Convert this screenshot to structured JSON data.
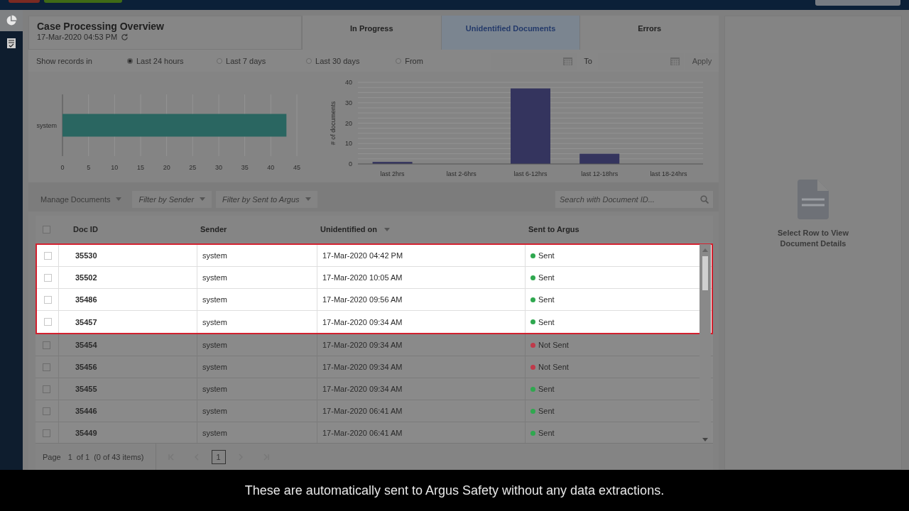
{
  "header": {
    "title": "Case Processing Overview",
    "timestamp": "17-Mar-2020 04:53 PM"
  },
  "tabs": [
    {
      "label": "In Progress",
      "selected": false
    },
    {
      "label": "Unidentified Documents",
      "selected": true
    },
    {
      "label": "Errors",
      "selected": false
    }
  ],
  "filter": {
    "label": "Show records in",
    "options": [
      {
        "label": "Last 24 hours",
        "selected": true
      },
      {
        "label": "Last 7 days",
        "selected": false
      },
      {
        "label": "Last 30 days",
        "selected": false
      },
      {
        "label": "From",
        "selected": false
      }
    ],
    "to_label": "To",
    "apply": "Apply"
  },
  "sender_chart": {
    "chart_data": {
      "type": "bar",
      "orientation": "horizontal",
      "grid": true,
      "categories": [
        "system"
      ],
      "values": [
        43
      ],
      "xlim": [
        0,
        45
      ],
      "xticks": [
        0,
        5,
        10,
        15,
        20,
        25,
        30,
        35,
        40,
        45
      ]
    }
  },
  "time_chart": {
    "chart_data": {
      "type": "bar",
      "grid": true,
      "ylabel": "# of documents",
      "categories": [
        "last 2hrs",
        "last 2-6hrs",
        "last 6-12hrs",
        "last 12-18hrs",
        "last 18-24hrs"
      ],
      "values": [
        1,
        0,
        37,
        5,
        0
      ],
      "ylim": [
        0,
        40
      ],
      "yticks": [
        0,
        10,
        20,
        30,
        40
      ]
    }
  },
  "toolbar": {
    "manage": "Manage Documents",
    "filter_sender": "Filter by Sender",
    "filter_sent": "Filter by Sent to Argus",
    "search_placeholder": "Search with Document ID..."
  },
  "table": {
    "select_all": {
      "checked": false
    },
    "columns": [
      "Doc ID",
      "Sender",
      "Unidentified on",
      "Sent to Argus"
    ],
    "rows": [
      {
        "doc_id": "35530",
        "sender": "system",
        "date": "17-Mar-2020 04:42 PM",
        "status": "Sent",
        "color": "#2fa84f",
        "highlighted": true
      },
      {
        "doc_id": "35502",
        "sender": "system",
        "date": "17-Mar-2020 10:05 AM",
        "status": "Sent",
        "color": "#2fa84f",
        "highlighted": true
      },
      {
        "doc_id": "35486",
        "sender": "system",
        "date": "17-Mar-2020 09:56 AM",
        "status": "Sent",
        "color": "#2fa84f",
        "highlighted": true
      },
      {
        "doc_id": "35457",
        "sender": "system",
        "date": "17-Mar-2020 09:34 AM",
        "status": "Sent",
        "color": "#2fa84f",
        "highlighted": true
      },
      {
        "doc_id": "35454",
        "sender": "system",
        "date": "17-Mar-2020 09:34 AM",
        "status": "Not Sent",
        "color": "#c03a4a",
        "highlighted": false
      },
      {
        "doc_id": "35456",
        "sender": "system",
        "date": "17-Mar-2020 09:34 AM",
        "status": "Not Sent",
        "color": "#c03a4a",
        "highlighted": false
      },
      {
        "doc_id": "35455",
        "sender": "system",
        "date": "17-Mar-2020 09:34 AM",
        "status": "Sent",
        "color": "#2fa84f",
        "highlighted": false
      },
      {
        "doc_id": "35446",
        "sender": "system",
        "date": "17-Mar-2020 06:41 AM",
        "status": "Sent",
        "color": "#2fa84f",
        "highlighted": false
      },
      {
        "doc_id": "35449",
        "sender": "system",
        "date": "17-Mar-2020 06:41 AM",
        "status": "Sent",
        "color": "#2fa84f",
        "highlighted": false
      }
    ]
  },
  "pager": {
    "page_label": "Page",
    "page": "1",
    "of": "of 1",
    "items": "(0 of 43 items)",
    "pages": [
      {
        "label": "1",
        "selected": true
      }
    ]
  },
  "details": {
    "message": "Select Row to View Document Details"
  },
  "caption": "These are automatically sent to Argus Safety without any data extractions."
}
